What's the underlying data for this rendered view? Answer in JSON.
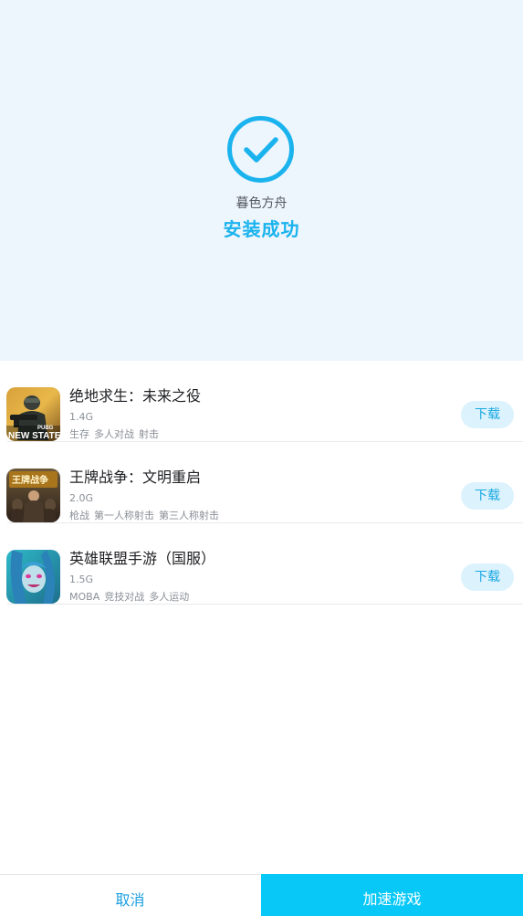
{
  "install": {
    "app_name": "暮色方舟",
    "status": "安装成功",
    "icon": "check-circle-icon",
    "accent_color": "#1ab3ee"
  },
  "games": [
    {
      "title": "绝地求生：未来之役",
      "size": "1.4G",
      "tags": [
        "生存",
        "多人对战",
        "射击"
      ],
      "icon": "pubg-new-state-icon",
      "icon_text": [
        "PUBG",
        "NEW STATE"
      ],
      "download_label": "下载"
    },
    {
      "title": "王牌战争：文明重启",
      "size": "2.0G",
      "tags": [
        "枪战",
        "第一人称射击",
        "第三人称射击"
      ],
      "icon": "ace-war-icon",
      "icon_text": [
        "王牌战争"
      ],
      "download_label": "下载"
    },
    {
      "title": "英雄联盟手游（国服）",
      "size": "1.5G",
      "tags": [
        "MOBA",
        "竞技对战",
        "多人运动"
      ],
      "icon": "league-of-legends-icon",
      "icon_text": [],
      "download_label": "下载"
    }
  ],
  "footer": {
    "cancel_label": "取消",
    "accelerate_label": "加速游戏",
    "accelerate_color": "#08c8f8"
  }
}
